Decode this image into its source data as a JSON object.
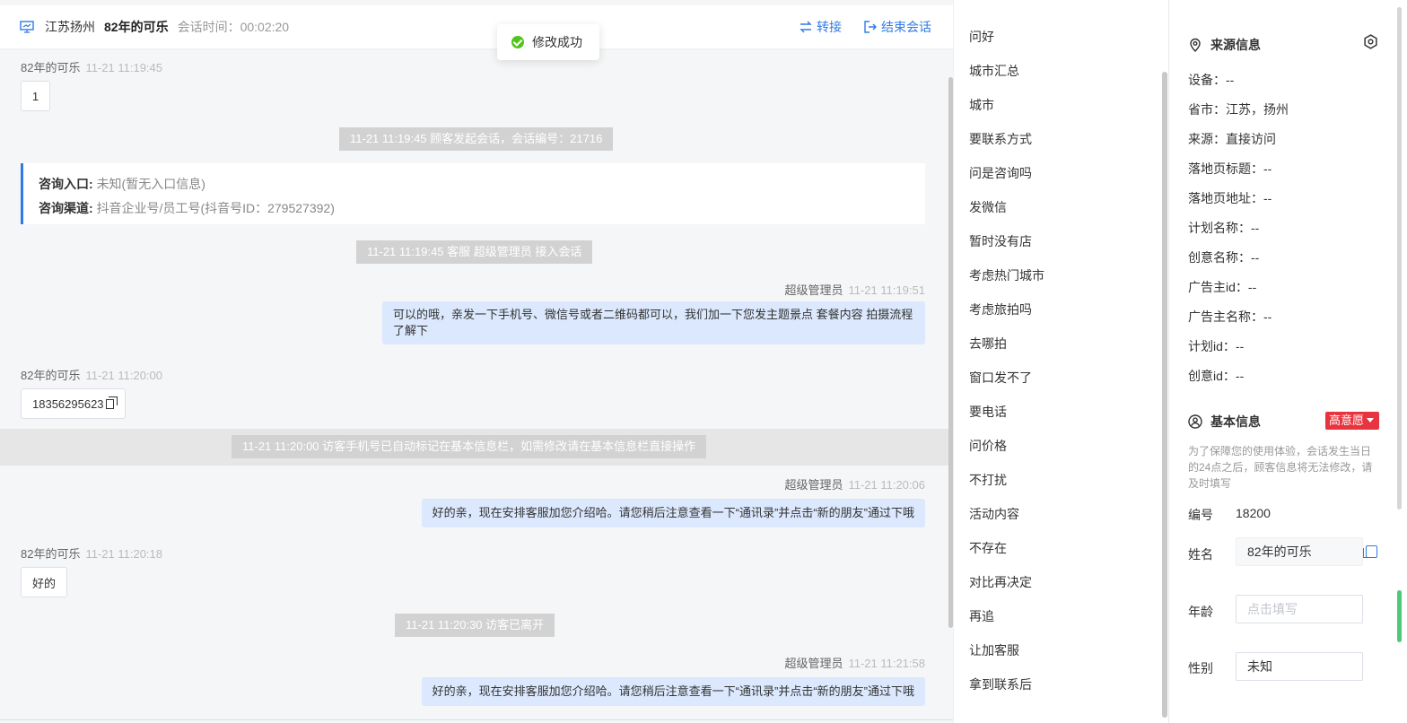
{
  "header": {
    "location": "江苏扬州",
    "name": "82年的可乐",
    "time_label": "会话时间：",
    "time": "00:02:20",
    "transfer_label": "转接",
    "end_label": "结束会话"
  },
  "toast": {
    "text": "修改成功"
  },
  "messages": {
    "m1": {
      "sender": "82年的可乐",
      "time": "11-21 11:19:45",
      "text": "1"
    },
    "sys1": "11-21 11:19:45 顾客发起会话，会话编号：21716",
    "entry": {
      "label1": "咨询入口:",
      "value1": "未知(暂无入口信息)",
      "label2": "咨询渠道:",
      "value2": "抖音企业号/员工号(抖音号ID：279527392)"
    },
    "sys2": "11-21 11:19:45 客服 超级管理员 接入会话",
    "m2": {
      "sender": "超级管理员",
      "time": "11-21 11:19:51",
      "text": "可以的哦，亲发一下手机号、微信号或者二维码都可以，我们加一下您发主题景点 套餐内容 拍摄流程了解下"
    },
    "m3": {
      "sender": "82年的可乐",
      "time": "11-21 11:20:00",
      "text": "18356295623"
    },
    "sys3": "11-21 11:20:00 访客手机号已自动标记在基本信息栏，如需修改请在基本信息栏直接操作",
    "m4": {
      "sender": "超级管理员",
      "time": "11-21 11:20:06",
      "text": "好的亲，现在安排客服加您介绍哈。请您稍后注意查看一下“通讯录”并点击“新的朋友”通过下哦"
    },
    "m5": {
      "sender": "82年的可乐",
      "time": "11-21 11:20:18",
      "text": "好的"
    },
    "sys4": "11-21 11:20:30 访客已离开",
    "m6": {
      "sender": "超级管理员",
      "time": "11-21 11:21:58",
      "text": "好的亲，现在安排客服加您介绍哈。请您稍后注意查看一下“通讯录”并点击“新的朋友”通过下哦"
    }
  },
  "quick_replies": [
    "问好",
    "城市汇总",
    "城市",
    "要联系方式",
    "问是咨询吗",
    "发微信",
    "暂时没有店",
    "考虑热门城市",
    "考虑旅拍吗",
    "去哪拍",
    "窗口发不了",
    "要电话",
    "问价格",
    "不打扰",
    "活动内容",
    "不存在",
    "对比再决定",
    "再追",
    "让加客服",
    "拿到联系后"
  ],
  "source": {
    "title": "来源信息",
    "rows": [
      {
        "k": "设备：",
        "v": "--"
      },
      {
        "k": "省市：",
        "v": "江苏，扬州"
      },
      {
        "k": "来源：",
        "v": "直接访问"
      },
      {
        "k": "落地页标题：",
        "v": "--"
      },
      {
        "k": "落地页地址：",
        "v": "--"
      },
      {
        "k": "计划名称：",
        "v": "--"
      },
      {
        "k": "创意名称：",
        "v": "--"
      },
      {
        "k": "广告主id：",
        "v": "--"
      },
      {
        "k": "广告主名称：",
        "v": "--"
      },
      {
        "k": "计划id：",
        "v": "--"
      },
      {
        "k": "创意id：",
        "v": "--"
      }
    ]
  },
  "basic": {
    "title": "基本信息",
    "badge": "高意愿",
    "note": "为了保障您的使用体验，会话发生当日的24点之后，顾客信息将无法修改，请及时填写",
    "id_label": "编号",
    "id_value": "18200",
    "name_label": "姓名",
    "name_value": "82年的可乐",
    "age_label": "年龄",
    "age_placeholder": "点击填写",
    "gender_label": "性别",
    "gender_value": "未知"
  },
  "colors": {
    "accent": "#2f7be5",
    "agent_bubble": "#dbe8fd",
    "badge": "#e8343f",
    "success": "#52c41a"
  }
}
